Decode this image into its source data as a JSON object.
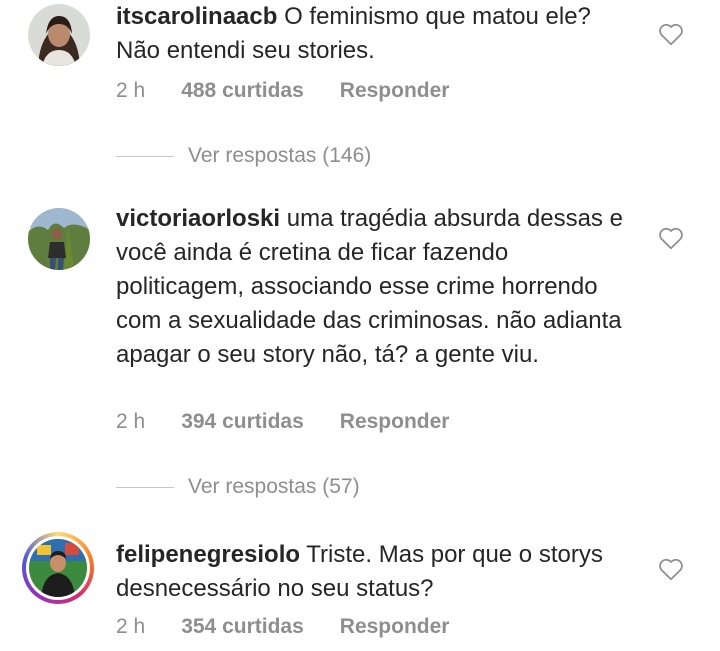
{
  "comments": [
    {
      "username": "itscarolinaacb",
      "text": "O feminismo que matou ele? Não entendi seu stories.",
      "time": "2 h",
      "likes": "488 curtidas",
      "reply": "Responder",
      "view_replies": "Ver respostas (146)",
      "heart_icon": "heart-outline-icon"
    },
    {
      "username": "victoriaorloski",
      "text": "uma tragédia absurda dessas e você ainda é cretina de ficar fazendo politicagem, associando esse crime horrendo com a sexualidade das criminosas. não adianta apagar o seu story não, tá? a gente viu.",
      "time": "2 h",
      "likes": "394 curtidas",
      "reply": "Responder",
      "view_replies": "Ver respostas (57)",
      "heart_icon": "heart-outline-icon"
    },
    {
      "username": "felipenegresiolo",
      "text": "Triste. Mas por que o storys desnecessário no seu status?",
      "time": "2 h",
      "likes": "354 curtidas",
      "reply": "Responder",
      "heart_icon": "heart-outline-icon",
      "story_ring": true
    }
  ],
  "colors": {
    "text": "#262626",
    "secondary": "#8e8e8e",
    "divider": "#c7c7c7",
    "story_ring": [
      "#feda75",
      "#fa7e1e",
      "#d62976",
      "#962fbf",
      "#4f5bd5"
    ]
  }
}
